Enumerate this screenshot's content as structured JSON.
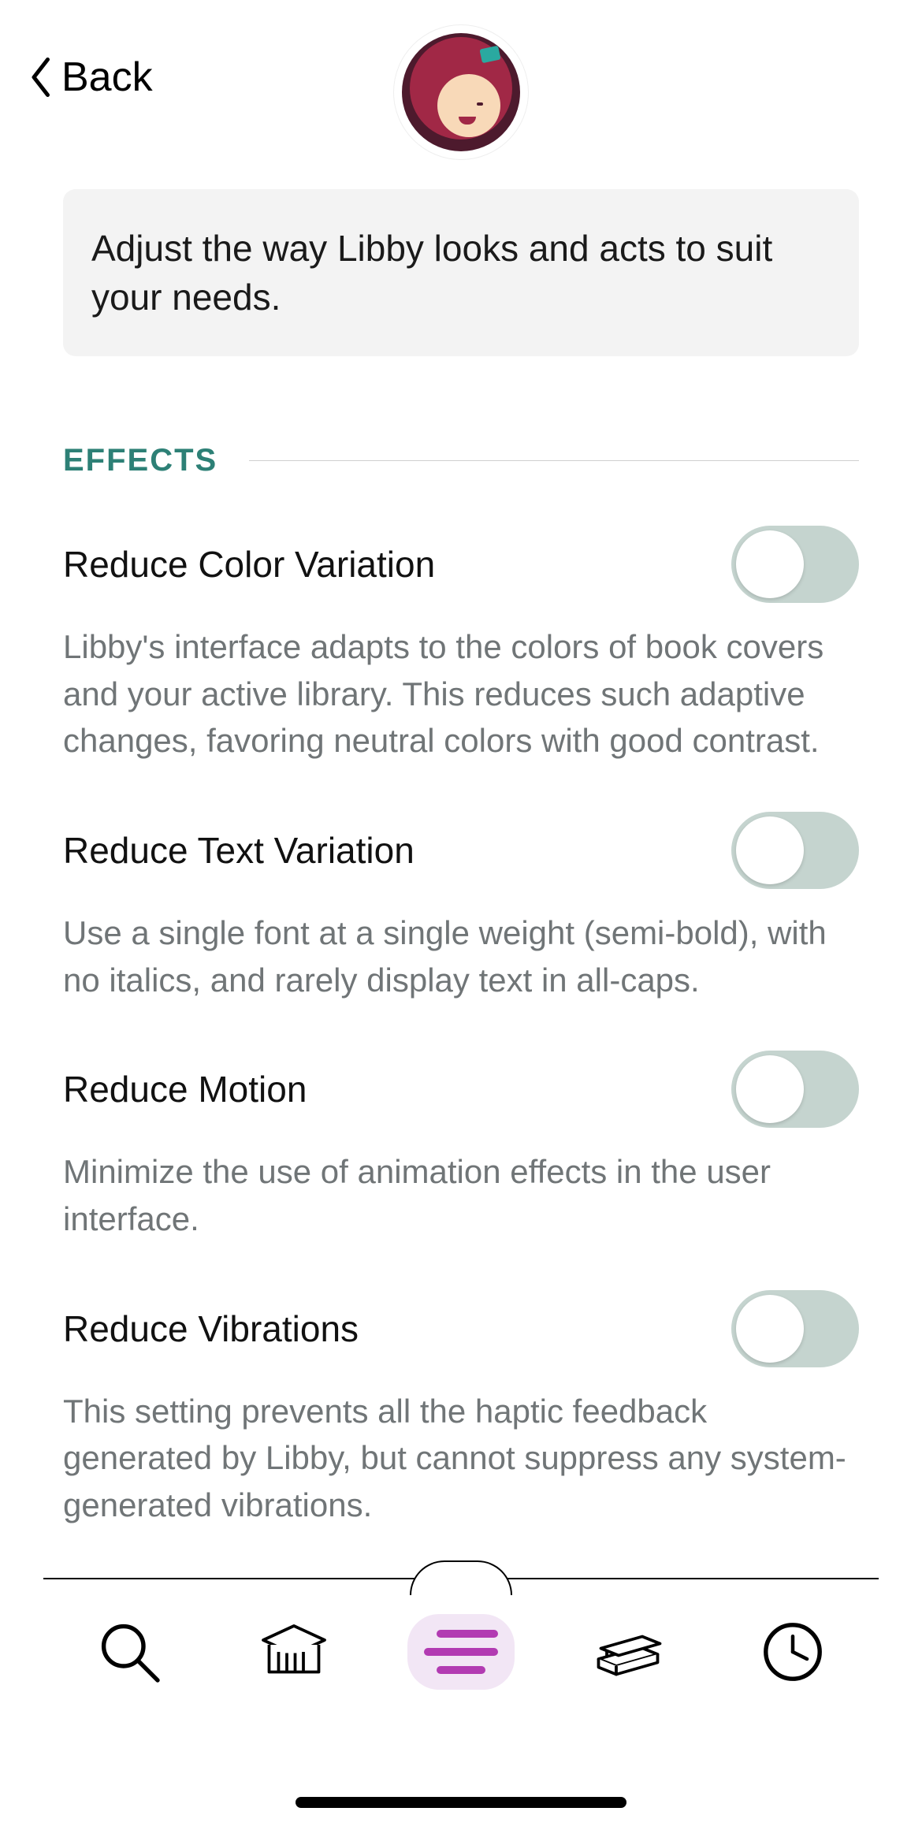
{
  "header": {
    "back_label": "Back"
  },
  "intro": "Adjust the way Libby looks and acts to suit your needs.",
  "section": {
    "title": "EFFECTS"
  },
  "settings": [
    {
      "label": "Reduce Color Variation",
      "desc": "Libby's interface adapts to the colors of book covers and your active library. This reduces such adaptive changes, favoring neutral colors with good contrast."
    },
    {
      "label": "Reduce Text Variation",
      "desc": "Use a single font at a single weight (semi-bold), with no italics, and rarely display text in all-caps."
    },
    {
      "label": "Reduce Motion",
      "desc": "Minimize the use of animation effects in the user interface."
    },
    {
      "label": "Reduce Vibrations",
      "desc": "This setting prevents all the haptic feedback generated by Libby, but cannot suppress any system-generated vibrations."
    }
  ]
}
